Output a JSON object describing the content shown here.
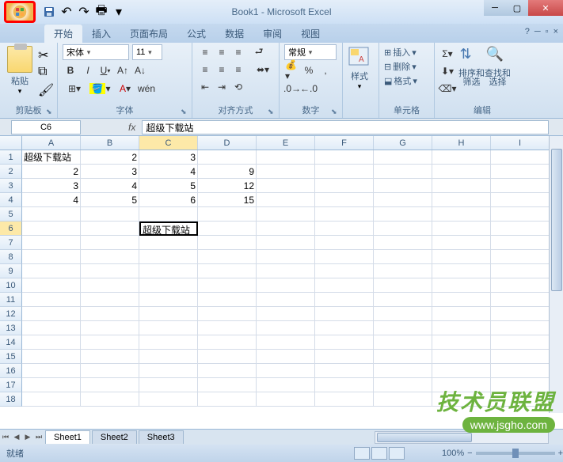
{
  "title": "Book1 - Microsoft Excel",
  "tabs": [
    "开始",
    "插入",
    "页面布局",
    "公式",
    "数据",
    "审阅",
    "视图"
  ],
  "tab_active": 0,
  "ribbon": {
    "clipboard": {
      "label": "剪贴板",
      "paste": "粘贴"
    },
    "font": {
      "label": "字体",
      "name": "宋体",
      "size": "11"
    },
    "align": {
      "label": "对齐方式"
    },
    "number": {
      "label": "数字",
      "format": "常规"
    },
    "styles": {
      "label": "样式",
      "item": "样式"
    },
    "cells": {
      "label": "单元格",
      "insert": "插入",
      "delete": "删除",
      "format": "格式"
    },
    "editing": {
      "label": "编辑",
      "sort": "排序和\n筛选",
      "find": "查找和\n选择"
    }
  },
  "name_box": "C6",
  "formula": "超级下载站",
  "cols": [
    "A",
    "B",
    "C",
    "D",
    "E",
    "F",
    "G",
    "H",
    "I"
  ],
  "row_count": 18,
  "active_col": 2,
  "active_row": 5,
  "cells": {
    "0": {
      "0": {
        "v": "超级下载站",
        "t": "txt"
      },
      "1": {
        "v": "2"
      },
      "2": {
        "v": "3"
      }
    },
    "1": {
      "0": {
        "v": "2"
      },
      "1": {
        "v": "3"
      },
      "2": {
        "v": "4"
      },
      "3": {
        "v": "9"
      }
    },
    "2": {
      "0": {
        "v": "3"
      },
      "1": {
        "v": "4"
      },
      "2": {
        "v": "5"
      },
      "3": {
        "v": "12"
      }
    },
    "3": {
      "0": {
        "v": "4"
      },
      "1": {
        "v": "5"
      },
      "2": {
        "v": "6"
      },
      "3": {
        "v": "15"
      }
    },
    "5": {
      "2": {
        "v": "超级下载站",
        "t": "sel"
      }
    }
  },
  "sheets": [
    "Sheet1",
    "Sheet2",
    "Sheet3"
  ],
  "active_sheet": 0,
  "status": "就绪",
  "zoom": "100%",
  "watermark": {
    "line1": "技术员联盟",
    "line2": "www.jsgho.com"
  }
}
